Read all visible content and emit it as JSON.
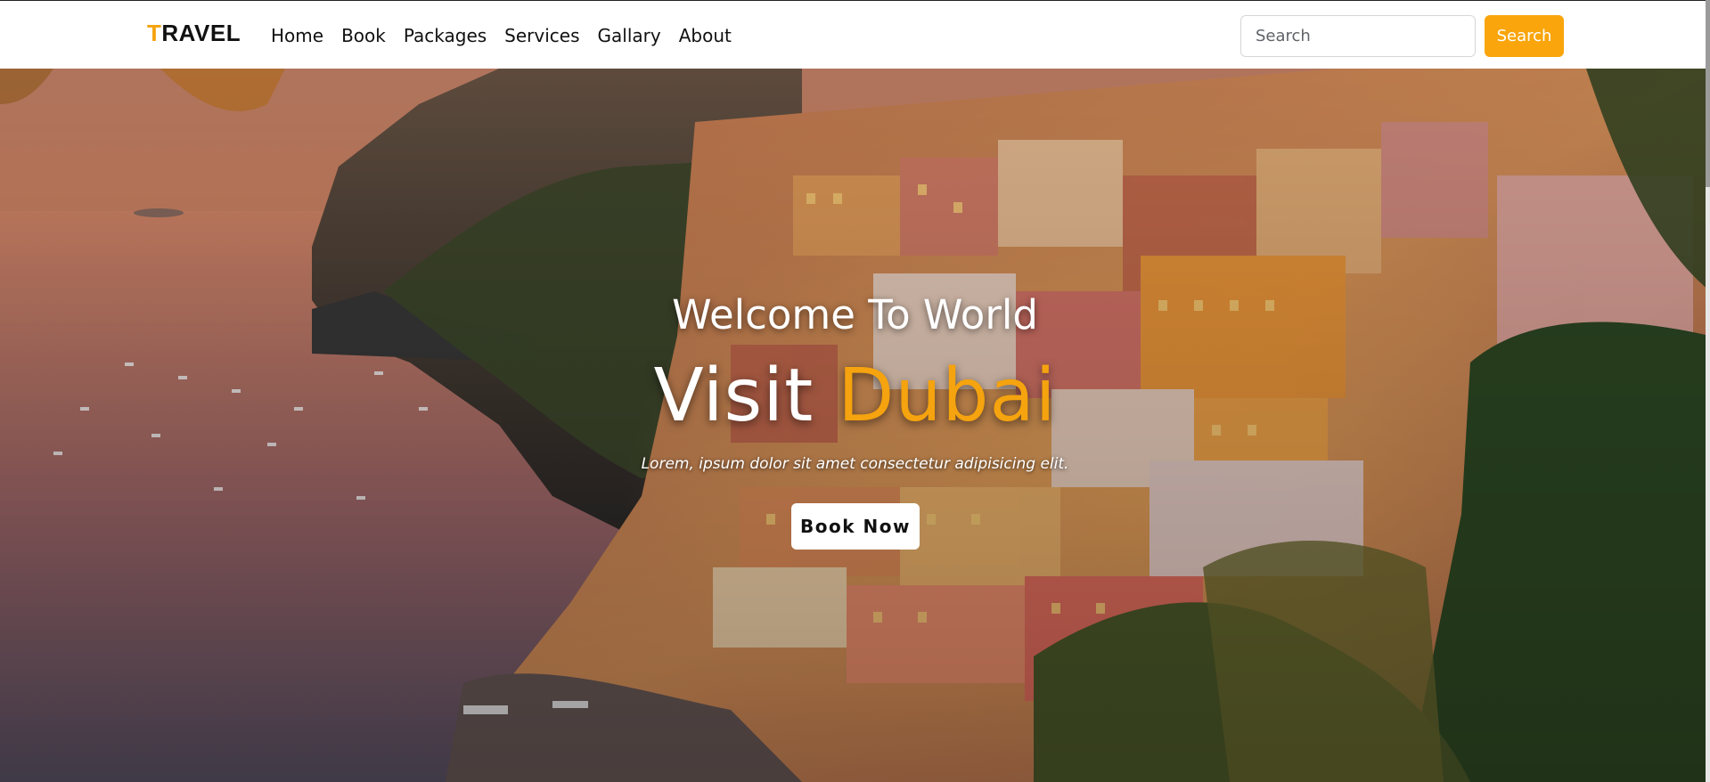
{
  "navbar": {
    "brand_first": "T",
    "brand_rest": "RAVEL",
    "links": [
      "Home",
      "Book",
      "Packages",
      "Services",
      "Gallary",
      "About"
    ],
    "search": {
      "placeholder": "Search",
      "button_label": "Search"
    }
  },
  "hero": {
    "welcome": "Welcome To World",
    "headline_plain": "Visit",
    "headline_accent": "Dubai",
    "tagline": "Lorem, ipsum dolor sit amet consectetur adipisicing elit.",
    "cta_label": "Book Now"
  },
  "colors": {
    "accent": "#f9a50b",
    "nav_bg": "#ffffff",
    "text_dark": "#111111",
    "hero_text": "#ffffff"
  },
  "icons": {
    "background": "coastal-cliff-town-photo"
  }
}
